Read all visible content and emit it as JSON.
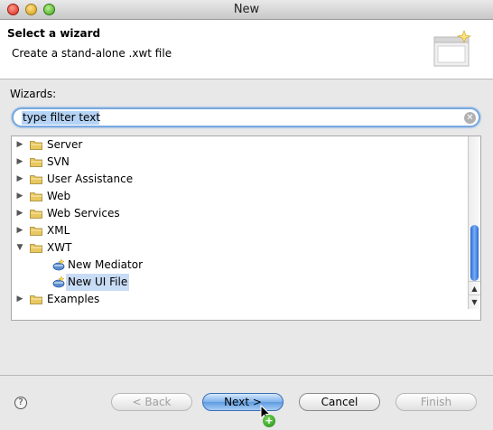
{
  "window": {
    "title": "New"
  },
  "header": {
    "title": "Select a wizard",
    "description": "Create a stand-alone .xwt file"
  },
  "wizards_label": "Wizards:",
  "filter": {
    "value": "type filter text",
    "placeholder": "type filter text"
  },
  "tree": {
    "items": [
      {
        "label": "Server",
        "type": "folder",
        "expanded": false
      },
      {
        "label": "SVN",
        "type": "folder",
        "expanded": false
      },
      {
        "label": "User Assistance",
        "type": "folder",
        "expanded": false
      },
      {
        "label": "Web",
        "type": "folder",
        "expanded": false
      },
      {
        "label": "Web Services",
        "type": "folder",
        "expanded": false
      },
      {
        "label": "XML",
        "type": "folder",
        "expanded": false
      },
      {
        "label": "XWT",
        "type": "folder",
        "expanded": true
      },
      {
        "label": "New Mediator",
        "type": "wizard",
        "selected": false
      },
      {
        "label": "New UI File",
        "type": "wizard",
        "selected": true
      },
      {
        "label": "Examples",
        "type": "folder",
        "expanded": false
      }
    ]
  },
  "buttons": {
    "back": "< Back",
    "next": "Next >",
    "cancel": "Cancel",
    "finish": "Finish"
  },
  "icons": {
    "help": "help-icon",
    "folder": "folder-icon",
    "wizard": "wizard-file-icon",
    "clear": "clear-icon"
  },
  "colors": {
    "selection": "#c9dcf5",
    "accent": "#5d9be0",
    "folder": "#e8c860"
  }
}
